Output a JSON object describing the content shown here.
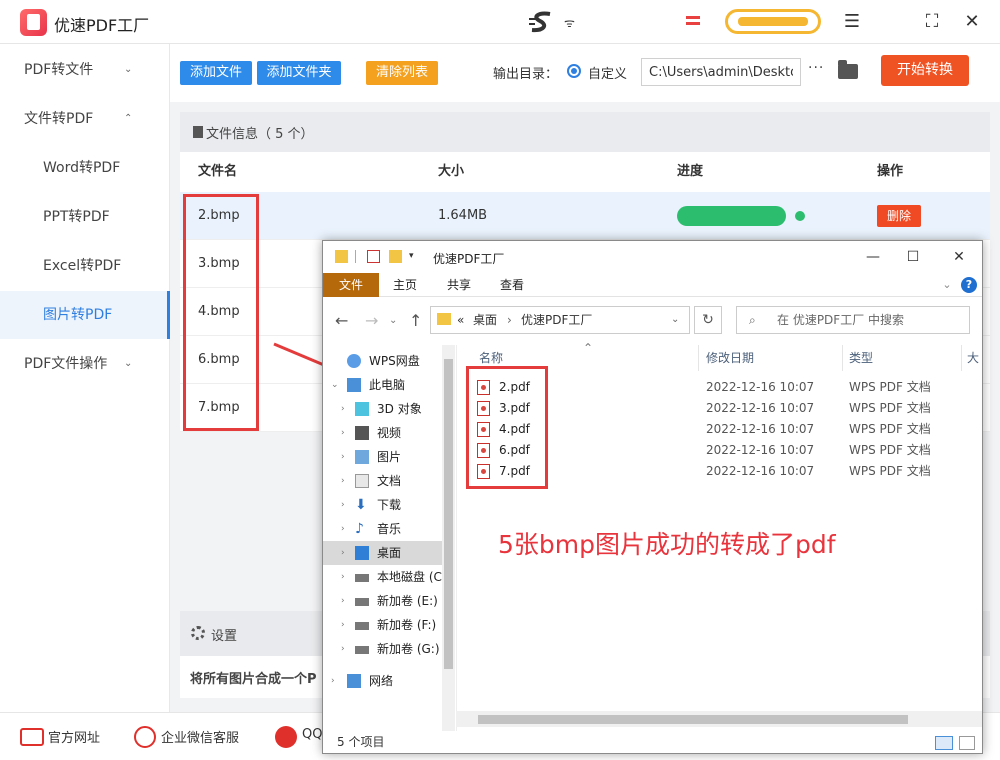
{
  "app": {
    "title": "优速PDF工厂",
    "brand_color": "#e8344a"
  },
  "sidebar": {
    "items": [
      {
        "label": "PDF转文件",
        "chevron": "⌄"
      },
      {
        "label": "文件转PDF",
        "chevron": "⌃"
      },
      {
        "label": "Word转PDF"
      },
      {
        "label": "PPT转PDF"
      },
      {
        "label": "Excel转PDF"
      },
      {
        "label": "图片转PDF",
        "active": true
      },
      {
        "label": "PDF文件操作",
        "chevron": "⌄"
      }
    ]
  },
  "toolbar": {
    "add_file": "添加文件",
    "add_folder": "添加文件夹",
    "clear_list": "清除列表",
    "output_label": "输出目录：",
    "radio_label": "自定义",
    "output_path": "C:\\Users\\admin\\Desktop",
    "more": "···",
    "start": "开始转换"
  },
  "file_list": {
    "title": "文件信息（ 5 个）",
    "headers": {
      "name": "文件名",
      "size": "大小",
      "progress": "进度",
      "action": "操作"
    },
    "rows": [
      {
        "name": "2.bmp",
        "size": "1.64MB",
        "progress": 1.0,
        "action": "删除"
      },
      {
        "name": "3.bmp"
      },
      {
        "name": "4.bmp"
      },
      {
        "name": "6.bmp"
      },
      {
        "name": "7.bmp"
      }
    ]
  },
  "settings": {
    "title": "设置",
    "option": "将所有图片合成一个P"
  },
  "footer": {
    "website": "官方网址",
    "wechat": "企业微信客服",
    "qq": "QQ"
  },
  "annotation": {
    "text": "5张bmp图片成功的转成了pdf",
    "color": "#e8353d"
  },
  "explorer": {
    "title": "优速PDF工厂",
    "tabs": [
      "文件",
      "主页",
      "共享",
      "查看"
    ],
    "address": {
      "prefix": "«",
      "parts": [
        "桌面",
        "›",
        "优速PDF工厂"
      ]
    },
    "search_placeholder": "在 优速PDF工厂 中搜索",
    "tree": [
      {
        "label": "WPS网盘"
      },
      {
        "label": "此电脑"
      },
      {
        "label": "3D 对象"
      },
      {
        "label": "视频"
      },
      {
        "label": "图片"
      },
      {
        "label": "文档"
      },
      {
        "label": "下载"
      },
      {
        "label": "音乐"
      },
      {
        "label": "桌面",
        "active": true
      },
      {
        "label": "本地磁盘 (C"
      },
      {
        "label": "新加卷 (E:)"
      },
      {
        "label": "新加卷 (F:)"
      },
      {
        "label": "新加卷 (G:)"
      },
      {
        "label": "网络"
      }
    ],
    "columns": {
      "name": "名称",
      "date": "修改日期",
      "type": "类型",
      "size": "大"
    },
    "files": [
      {
        "name": "2.pdf",
        "date": "2022-12-16 10:07",
        "type": "WPS PDF 文档"
      },
      {
        "name": "3.pdf",
        "date": "2022-12-16 10:07",
        "type": "WPS PDF 文档"
      },
      {
        "name": "4.pdf",
        "date": "2022-12-16 10:07",
        "type": "WPS PDF 文档"
      },
      {
        "name": "6.pdf",
        "date": "2022-12-16 10:07",
        "type": "WPS PDF 文档"
      },
      {
        "name": "7.pdf",
        "date": "2022-12-16 10:07",
        "type": "WPS PDF 文档"
      }
    ],
    "status": "5 个项目"
  }
}
